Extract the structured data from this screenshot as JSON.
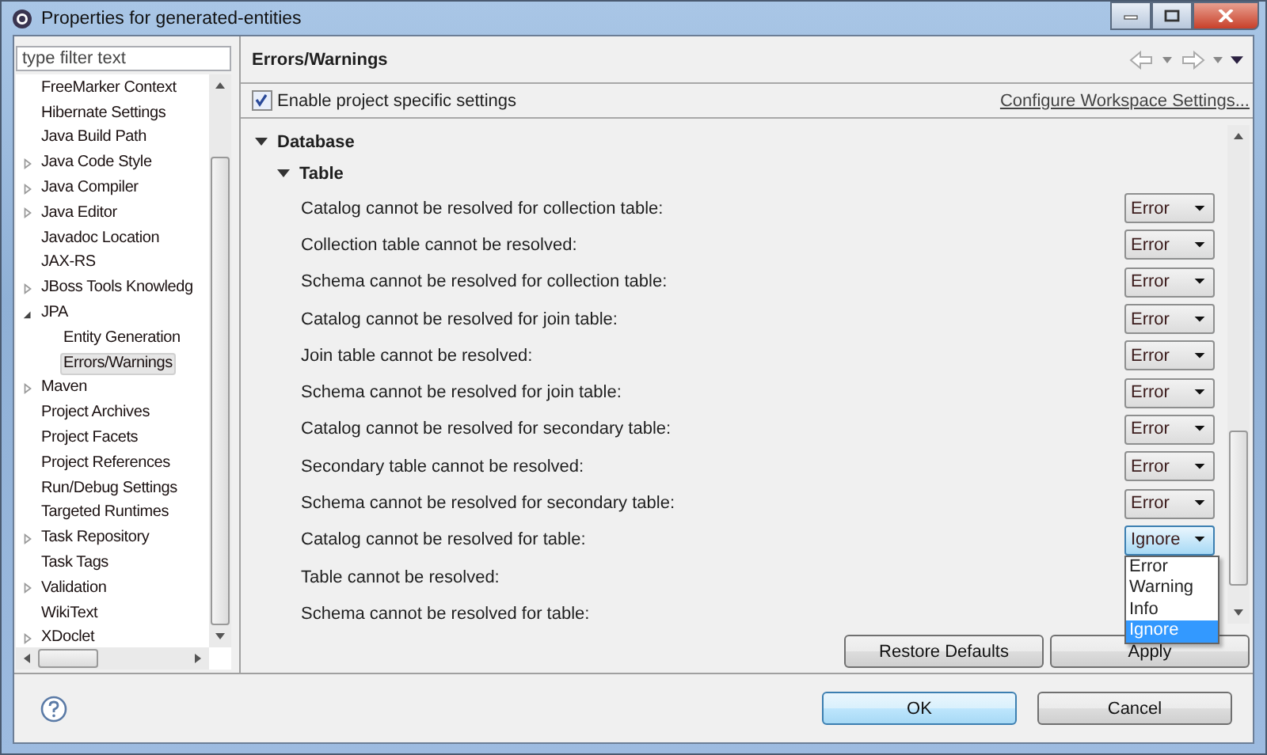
{
  "window": {
    "title": "Properties for generated-entities"
  },
  "filter": {
    "placeholder": "type filter text"
  },
  "tree": [
    {
      "label": "FreeMarker Context",
      "kind": "leaf",
      "selected": false
    },
    {
      "label": "Hibernate Settings",
      "kind": "leaf",
      "selected": false
    },
    {
      "label": "Java Build Path",
      "kind": "leaf",
      "selected": false
    },
    {
      "label": "Java Code Style",
      "kind": "collapsed",
      "selected": false
    },
    {
      "label": "Java Compiler",
      "kind": "collapsed",
      "selected": false
    },
    {
      "label": "Java Editor",
      "kind": "collapsed",
      "selected": false
    },
    {
      "label": "Javadoc Location",
      "kind": "leaf",
      "selected": false
    },
    {
      "label": "JAX-RS",
      "kind": "leaf",
      "selected": false
    },
    {
      "label": "JBoss Tools Knowledg",
      "kind": "collapsed",
      "selected": false
    },
    {
      "label": "JPA",
      "kind": "expanded",
      "selected": false,
      "children": [
        {
          "label": "Entity Generation",
          "kind": "leaf",
          "selected": false
        },
        {
          "label": "Errors/Warnings",
          "kind": "leaf",
          "selected": true
        }
      ]
    },
    {
      "label": "Maven",
      "kind": "collapsed",
      "selected": false
    },
    {
      "label": "Project Archives",
      "kind": "leaf",
      "selected": false
    },
    {
      "label": "Project Facets",
      "kind": "leaf",
      "selected": false
    },
    {
      "label": "Project References",
      "kind": "leaf",
      "selected": false
    },
    {
      "label": "Run/Debug Settings",
      "kind": "leaf",
      "selected": false
    },
    {
      "label": "Targeted Runtimes",
      "kind": "leaf",
      "selected": false
    },
    {
      "label": "Task Repository",
      "kind": "collapsed",
      "selected": false
    },
    {
      "label": "Task Tags",
      "kind": "leaf",
      "selected": false
    },
    {
      "label": "Validation",
      "kind": "collapsed",
      "selected": false
    },
    {
      "label": "WikiText",
      "kind": "leaf",
      "selected": false
    },
    {
      "label": "XDoclet",
      "kind": "collapsed",
      "selected": false
    }
  ],
  "page": {
    "title": "Errors/Warnings",
    "project_specific": {
      "label": "Enable project specific settings",
      "checked": true
    },
    "workspace_link": "Configure Workspace Settings...",
    "sections": [
      {
        "label": "Database",
        "expanded": true,
        "children": [
          {
            "label": "Table",
            "expanded": true,
            "rows": [
              {
                "label": "Catalog cannot be resolved for collection table:",
                "value": "Error",
                "open": false
              },
              {
                "label": "Collection table cannot be resolved:",
                "value": "Error",
                "open": false
              },
              {
                "label": "Schema cannot be resolved for collection table:",
                "value": "Error",
                "open": false
              },
              {
                "label": "Catalog cannot be resolved for join table:",
                "value": "Error",
                "open": false
              },
              {
                "label": "Join table cannot be resolved:",
                "value": "Error",
                "open": false
              },
              {
                "label": "Schema cannot be resolved for join table:",
                "value": "Error",
                "open": false
              },
              {
                "label": "Catalog cannot be resolved for secondary table:",
                "value": "Error",
                "open": false
              },
              {
                "label": "Secondary table cannot be resolved:",
                "value": "Error",
                "open": false
              },
              {
                "label": "Schema cannot be resolved for secondary table:",
                "value": "Error",
                "open": false
              },
              {
                "label": "Catalog cannot be resolved for table:",
                "value": "Ignore",
                "open": true,
                "options": [
                  {
                    "label": "Error",
                    "selected": false
                  },
                  {
                    "label": "Warning",
                    "selected": false
                  },
                  {
                    "label": "Info",
                    "selected": false
                  },
                  {
                    "label": "Ignore",
                    "selected": true
                  }
                ]
              },
              {
                "label": "Table cannot be resolved:"
              },
              {
                "label": "Schema cannot be resolved for table:"
              }
            ]
          }
        ]
      }
    ],
    "restore_button": "Restore Defaults",
    "apply_button": "Apply"
  },
  "buttons": [
    {
      "label": "OK",
      "default": true
    },
    {
      "label": "Cancel",
      "default": false
    }
  ]
}
